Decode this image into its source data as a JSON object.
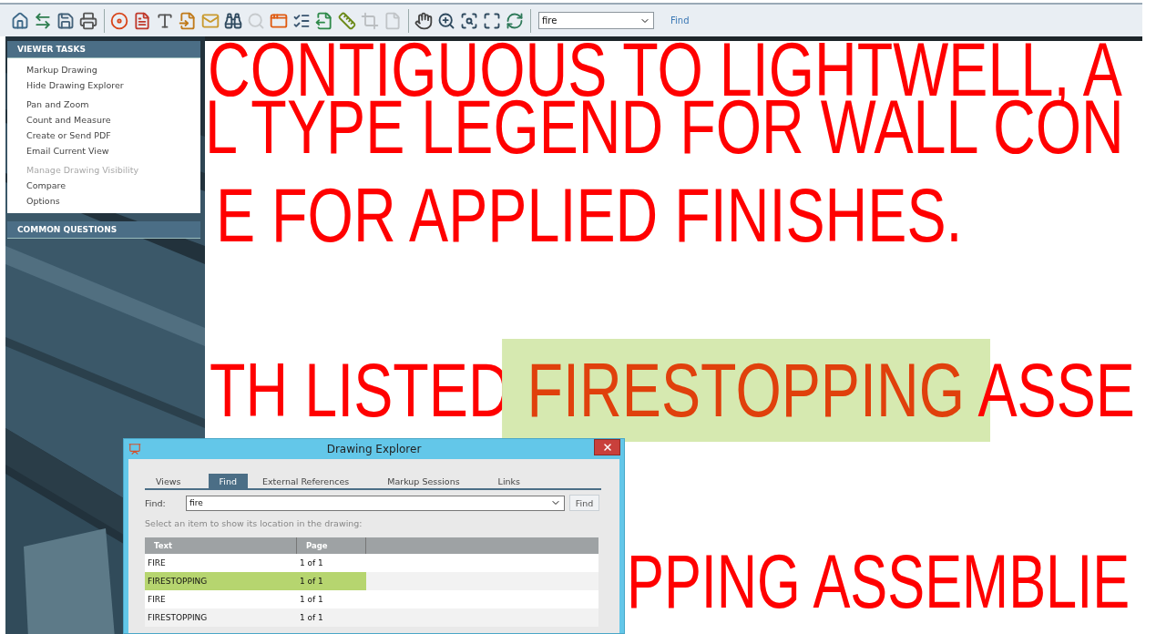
{
  "toolbar": {
    "tools": [
      {
        "disabled": false
      },
      {
        "disabled": false
      },
      {
        "disabled": false
      },
      {
        "disabled": false
      },
      {
        "disabled": false
      },
      {
        "disabled": false
      },
      {
        "disabled": false
      },
      {
        "disabled": false
      },
      {
        "disabled": false
      },
      {
        "disabled": false
      },
      {
        "disabled": true
      },
      {
        "disabled": false
      },
      {
        "disabled": false
      },
      {
        "disabled": false
      },
      {
        "disabled": false
      },
      {
        "disabled": true
      },
      {
        "disabled": true
      },
      {
        "disabled": false
      },
      {
        "disabled": false
      },
      {
        "disabled": false
      },
      {
        "disabled": false
      },
      {
        "disabled": false
      }
    ],
    "search": {
      "value": "fire"
    },
    "find_link": "Find"
  },
  "sidebar": {
    "panels": [
      {
        "title": "VIEWER TASKS",
        "groups": [
          [
            {
              "label": "Markup Drawing",
              "disabled": false
            },
            {
              "label": "Hide Drawing Explorer",
              "disabled": false
            }
          ],
          [
            {
              "label": "Pan and Zoom",
              "disabled": false
            },
            {
              "label": "Count and Measure",
              "disabled": false
            },
            {
              "label": "Create or Send PDF",
              "disabled": false
            },
            {
              "label": "Email Current View",
              "disabled": false
            }
          ],
          [
            {
              "label": "Manage Drawing Visibility",
              "disabled": true
            },
            {
              "label": "Compare",
              "disabled": false
            },
            {
              "label": "Options",
              "disabled": false
            }
          ]
        ]
      },
      {
        "title": "COMMON QUESTIONS"
      }
    ]
  },
  "drawing": {
    "lines": [
      {
        "segments": [
          {
            "text": "CONTIGUOUS TO LIGHTWELL, A",
            "highlighted": false
          }
        ]
      },
      {
        "segments": [
          {
            "text": "L TYPE LEGEND FOR WALL CON",
            "highlighted": false
          }
        ]
      },
      {
        "segments": [
          {
            "text": "E FOR APPLIED FINISHES.",
            "highlighted": false
          }
        ]
      },
      {
        "segments": [
          {
            "text": "TH LISTED ",
            "highlighted": false
          },
          {
            "text": "FIRESTOPPING",
            "highlighted": true
          },
          {
            "text": " ASSE",
            "highlighted": false
          }
        ]
      },
      {
        "segments": [
          {
            "text": "PPING ASSEMBLIE",
            "highlighted": false
          }
        ]
      }
    ]
  },
  "dialog": {
    "title": "Drawing Explorer",
    "tabs": [
      {
        "label": "Views",
        "selected": false
      },
      {
        "label": "Find",
        "selected": true
      },
      {
        "label": "External References",
        "selected": false
      },
      {
        "label": "Markup Sessions",
        "selected": false
      },
      {
        "label": "Links",
        "selected": false
      }
    ],
    "find_label": "Find:",
    "find_value": "fire",
    "find_button": "Find",
    "hint": "Select an item to show its location in the drawing:",
    "table": {
      "columns": [
        "Text",
        "Page"
      ],
      "rows": [
        {
          "cells": [
            "FIRE",
            "1 of 1"
          ],
          "selected": false
        },
        {
          "cells": [
            "FIRESTOPPING",
            "1 of 1"
          ],
          "selected": true
        },
        {
          "cells": [
            "FIRE",
            "1 of 1"
          ],
          "selected": false
        },
        {
          "cells": [
            "FIRESTOPPING",
            "1 of 1"
          ],
          "selected": false
        }
      ]
    }
  }
}
